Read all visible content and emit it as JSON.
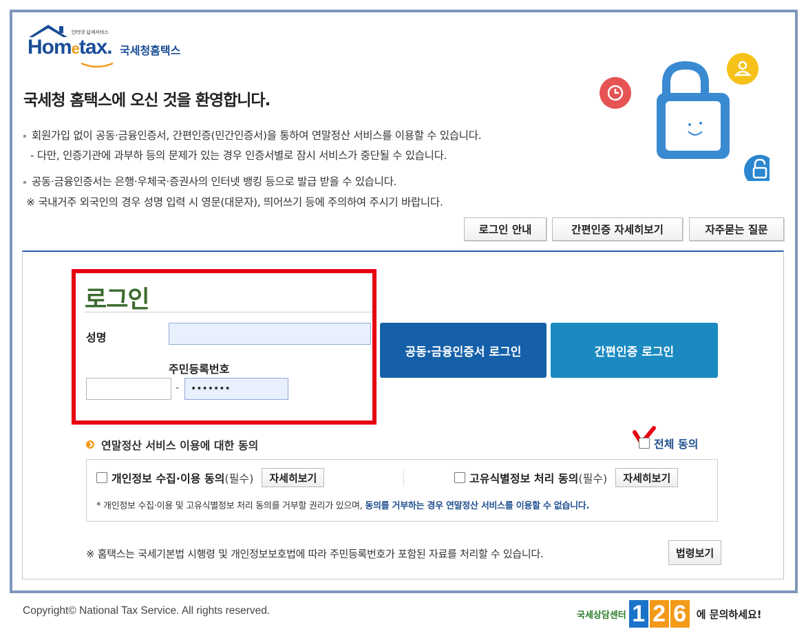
{
  "logo": {
    "small_text": "인터넷 납세서비스",
    "word_pre": "Hom",
    "word_e": "e",
    "word_post": "tax.",
    "korean": "국세청홈택스"
  },
  "welcome": "국세청 홈택스에 오신 것을 환영합니다.",
  "info": {
    "line1": "회원가입 없이 공동·금융인증서, 간편인증(민간인증서)을 통하여 연말정산 서비스를 이용할 수 있습니다.",
    "line2": "- 다만, 인증기관에 과부하 등의 문제가 있는 경우 인증서별로 잠시 서비스가 중단될 수 있습니다.",
    "line3": "공동·금융인증서는 은행·우체국·증권사의 인터넷 뱅킹 등으로 발급 받을 수 있습니다.",
    "line4": "※ 국내거주 외국인의 경우 성명 입력 시 영문(대문자), 띄어쓰기 등에 주의하여 주시기 바랍니다."
  },
  "top_buttons": {
    "login_guide": "로그인 안내",
    "simple_auth_detail": "간편인증 자세히보기",
    "faq": "자주묻는 질문"
  },
  "login": {
    "title": "로그인",
    "name_label": "성명",
    "name_value": "",
    "rrn_label": "주민등록번호",
    "rrn_front": "",
    "rrn_dash": "-",
    "rrn_back": "•••••••",
    "cert_login": "공동·금융인증서 로그인",
    "simple_login": "간편인증 로그인"
  },
  "consent": {
    "heading": "연말정산 서비스 이용에 대한 동의",
    "agree_all": "전체 동의",
    "item1_label": "개인정보 수집·이용 동의",
    "item1_req": "(필수)",
    "item2_label": "고유식별정보 처리 동의",
    "item2_req": "(필수)",
    "detail_button": "자세히보기",
    "note_plain": "* 개인정보 수집·이용 및 고유식별정보 처리 동의를 거부할 권리가 있으며, ",
    "note_bold": "동의를 거부하는 경우 연말정산 서비스를 이용할 수 없습니다."
  },
  "law": {
    "note": "※ 홈택스는 국세기본법 시행령 및 개인정보보호법에 따라 주민등록번호가 포함된 자료를 처리할 수 있습니다.",
    "button": "법령보기"
  },
  "footer": {
    "copyright": "Copyright© National Tax Service. All rights reserved.",
    "center_name": "국세상담센터",
    "center_digits": [
      "1",
      "2",
      "6"
    ],
    "ask": "에 문의하세요!"
  },
  "colors": {
    "brand_blue": "#1a4d97",
    "cert_button": "#1560a8",
    "simple_button": "#1a8ac0",
    "highlight_red": "#e60012",
    "login_title_green": "#3c6b2e",
    "digit_colors": [
      "#1a73c9",
      "#f39a19",
      "#f39a19"
    ]
  },
  "icons": {
    "clock": "clock-icon",
    "person": "person-icon",
    "padlock": "padlock-icon",
    "lock_small": "small-lock-icon"
  }
}
